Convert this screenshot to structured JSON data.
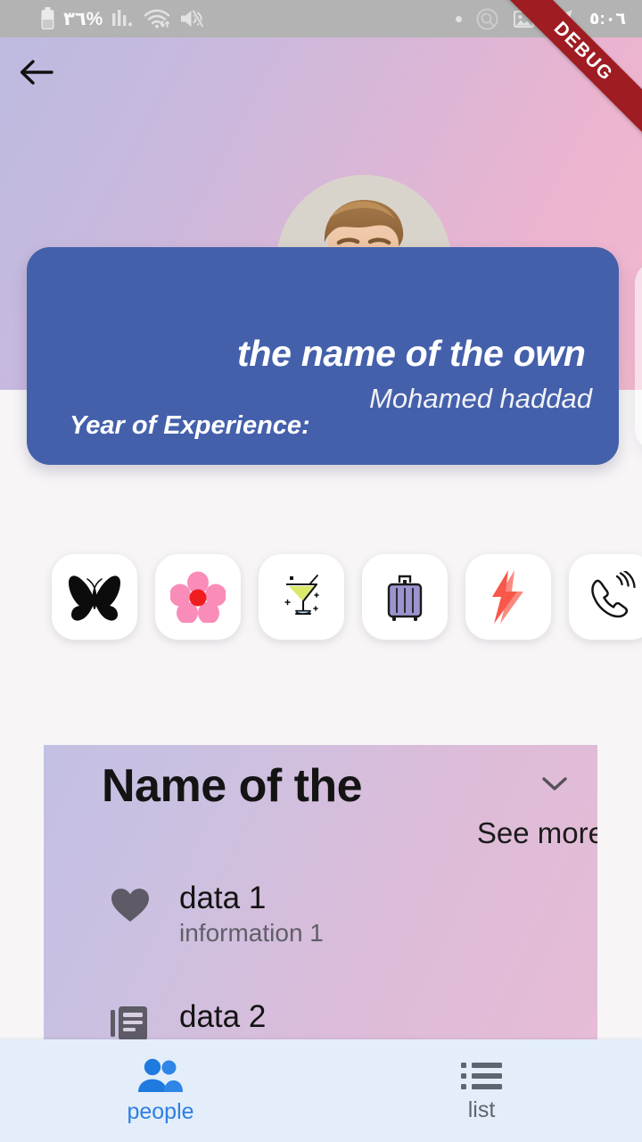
{
  "status_bar": {
    "battery_percent": "٣٦%",
    "clock": "٥:٠٦",
    "icons": [
      "battery-icon",
      "signal-bars-icon",
      "wifi-icon",
      "mute-vibrate-icon",
      "dot-indicator-icon",
      "screen-record-icon",
      "gallery-icon",
      "telegram-icon"
    ],
    "background": "#b3b3b3"
  },
  "debug_banner": {
    "label": "DEBUG",
    "color": "#9e1c22"
  },
  "app_bar": {
    "back_label": "Back",
    "icon": "arrow-left-icon"
  },
  "profile_card": {
    "title": "the name of the own",
    "owner_name": "Mohamed haddad",
    "experience_label": "Year of Experience:",
    "background": "#4460ab",
    "avatar_alt": "profile photo"
  },
  "category_tiles": [
    {
      "name": "butterfly",
      "icon": "butterfly-icon"
    },
    {
      "name": "flower",
      "icon": "flower-icon"
    },
    {
      "name": "cocktail",
      "icon": "cocktail-icon"
    },
    {
      "name": "luggage",
      "icon": "luggage-icon"
    },
    {
      "name": "lightning",
      "icon": "lightning-bolt-icon"
    },
    {
      "name": "phone call",
      "icon": "phone-ringing-icon"
    }
  ],
  "info_card": {
    "title": "Name of the",
    "see_more": "See more",
    "expand_icon": "chevron-down-icon",
    "rows": [
      {
        "icon": "heart-icon",
        "title": "data 1",
        "subtitle": "information 1"
      },
      {
        "icon": "article-icon",
        "title": "data 2",
        "subtitle": ""
      }
    ]
  },
  "bottom_nav": {
    "items": [
      {
        "label": "people",
        "icon": "people-icon",
        "active": true,
        "color": "#2f7fe0"
      },
      {
        "label": "list",
        "icon": "list-icon",
        "active": false,
        "color": "#5d6670"
      }
    ],
    "background": "#e3eefa"
  }
}
